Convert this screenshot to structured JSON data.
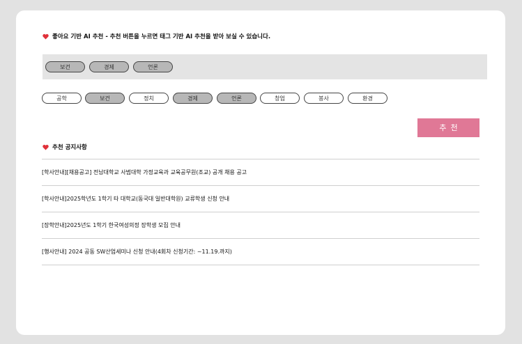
{
  "colors": {
    "accent": "#e07896",
    "heart": "#e0313a",
    "selected_pill": "#b7b7b7",
    "selected_bar": "#e4e4e4"
  },
  "header": {
    "title": "좋아요 기반 AI 추천 - 추천 버튼을 누르면 태그 기반 AI 추천을 받아 보실 수 있습니다.",
    "icon": "heart-icon"
  },
  "selected_tags": [
    "보건",
    "경제",
    "언론"
  ],
  "tags": [
    {
      "label": "공학",
      "selected": false
    },
    {
      "label": "보건",
      "selected": true
    },
    {
      "label": "정치",
      "selected": false
    },
    {
      "label": "경제",
      "selected": true
    },
    {
      "label": "언론",
      "selected": true
    },
    {
      "label": "창업",
      "selected": false
    },
    {
      "label": "봉사",
      "selected": false
    },
    {
      "label": "환경",
      "selected": false
    }
  ],
  "recommend_button": "추천",
  "notices": {
    "title": "추천 공지사항",
    "items": [
      "[학사안내][채용공고] 전남대학교 사범대학 가정교육과 교육공무원(조교) 공개 채용 공고",
      "[학사안내]2025학년도 1학기 타 대학교(동국대 일반대학원) 교류학생 신청 안내",
      "[장학안내]2025년도 1학기 한국여성의정 장학생 모집 안내",
      "[행사안내] 2024 공동 SW산업세미나 신청 안내(4회차 신청기간: ~11.19.까지)"
    ]
  }
}
